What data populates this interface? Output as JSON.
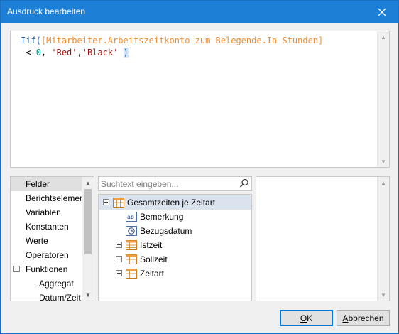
{
  "window": {
    "title": "Ausdruck bearbeiten"
  },
  "editor": {
    "tokens": {
      "func": "Iif(",
      "field_open": "[Mitarbeiter.Arbeitszeitkonto zum Belegende.In Stunden]",
      "lt": " < ",
      "zero": "0",
      "comma1": ", ",
      "red": "'Red'",
      "comma2": ",",
      "black": "'Black'",
      "space": " ",
      "close_paren": ")"
    }
  },
  "categories": [
    {
      "label": "Felder",
      "selected": true
    },
    {
      "label": "Berichtselemente"
    },
    {
      "label": "Variablen"
    },
    {
      "label": "Konstanten"
    },
    {
      "label": "Werte"
    },
    {
      "label": "Operatoren"
    },
    {
      "label": "Funktionen",
      "expander": "collapse"
    },
    {
      "label": "Aggregat"
    },
    {
      "label": "Datum/Zeit"
    }
  ],
  "search": {
    "placeholder": "Suchtext eingeben..."
  },
  "tree": {
    "root": {
      "label": "Gesamtzeiten je Zeitart"
    },
    "children": [
      {
        "label": "Bemerkung",
        "icon": "text-field-icon"
      },
      {
        "label": "Bezugsdatum",
        "icon": "date-field-icon"
      },
      {
        "label": "Istzeit",
        "icon": "table-icon"
      },
      {
        "label": "Sollzeit",
        "icon": "table-icon"
      },
      {
        "label": "Zeitart",
        "icon": "table-icon"
      }
    ]
  },
  "buttons": {
    "ok": {
      "accel": "O",
      "rest": "K"
    },
    "cancel": {
      "accel": "A",
      "rest": "bbrechen"
    }
  },
  "colors": {
    "titlebar": "#1e7fd6",
    "keyword": "#2e5fb0",
    "field": "#f08c2e",
    "number": "#009688",
    "string": "#a31515"
  }
}
